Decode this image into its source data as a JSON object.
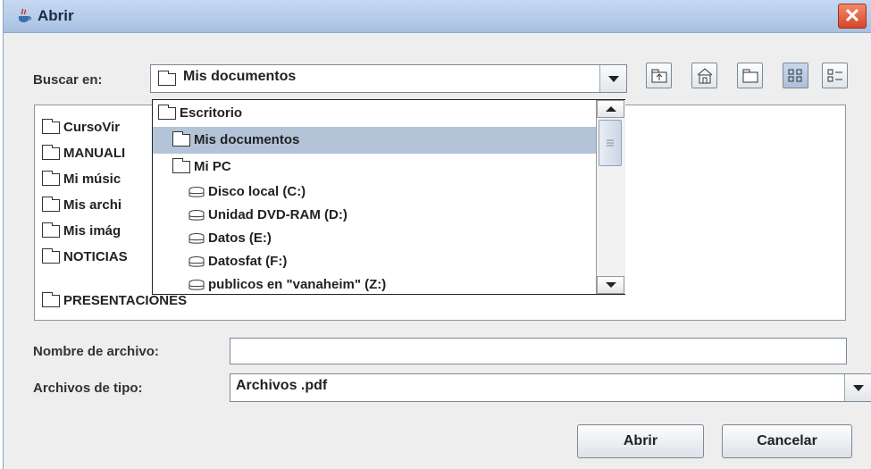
{
  "window": {
    "title": "Abrir",
    "close_glyph": "✕"
  },
  "look_in": {
    "label": "Buscar en:",
    "value": "Mis documentos"
  },
  "toolbar": {
    "icons": [
      "up-folder-icon",
      "home-icon",
      "new-folder-icon",
      "list-view-icon",
      "details-view-icon"
    ]
  },
  "files": [
    {
      "name": "CursoVir"
    },
    {
      "name": "MANUALI"
    },
    {
      "name": "Mi músic"
    },
    {
      "name": "Mis archi"
    },
    {
      "name": "Mis imág"
    },
    {
      "name": "NOTICIAS"
    },
    {
      "name": "PRESENTACIONES"
    }
  ],
  "dropdown": {
    "items": [
      {
        "label": "Escritorio",
        "icon": "folder-icon"
      },
      {
        "label": "Mis documentos",
        "icon": "folder-icon",
        "selected": true
      },
      {
        "label": "Mi PC",
        "icon": "folder-icon"
      },
      {
        "label": "Disco local (C:)",
        "icon": "drive-icon"
      },
      {
        "label": "Unidad DVD-RAM (D:)",
        "icon": "drive-icon"
      },
      {
        "label": "Datos (E:)",
        "icon": "drive-icon"
      },
      {
        "label": "Datosfat (F:)",
        "icon": "drive-icon"
      },
      {
        "label": "publicos en \"vanaheim\" (Z:)",
        "icon": "drive-icon"
      }
    ]
  },
  "filename": {
    "label": "Nombre de archivo:",
    "value": ""
  },
  "filetype": {
    "label": "Archivos de tipo:",
    "value": "Archivos .pdf"
  },
  "buttons": {
    "open": "Abrir",
    "cancel": "Cancelar"
  },
  "colors": {
    "title_bar": "#b6cbe9",
    "selection": "#b3c4d8",
    "close": "#d9462a"
  }
}
